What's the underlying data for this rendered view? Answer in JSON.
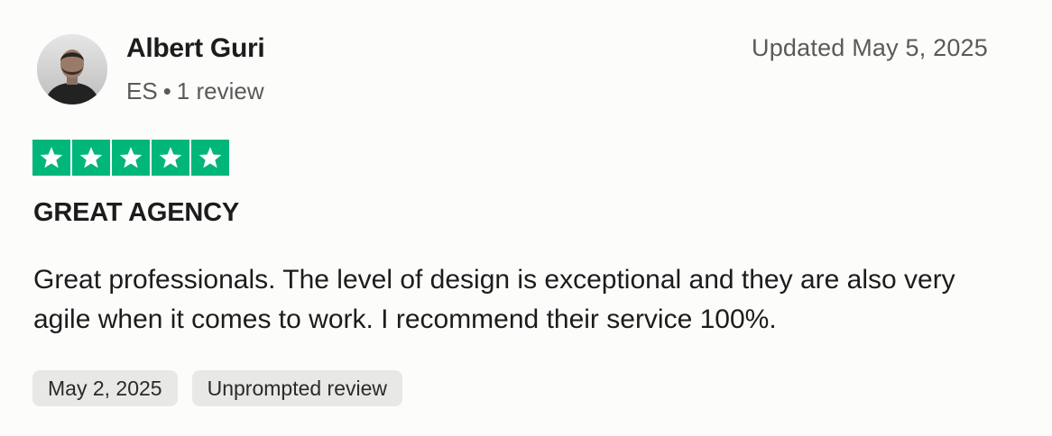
{
  "reviewer": {
    "name": "Albert Guri",
    "country": "ES",
    "separator": "•",
    "review_count": "1 review",
    "avatar": "avatar-photo"
  },
  "updated": "Updated May 5, 2025",
  "rating": {
    "value": 5,
    "max": 5,
    "color": "#00b67a"
  },
  "review": {
    "title": "GREAT AGENCY",
    "body": "Great professionals. The level of design is exceptional and they are also very agile when it comes to work. I recommend their service 100%."
  },
  "tags": [
    {
      "label": "May 2, 2025"
    },
    {
      "label": "Unprompted review"
    }
  ]
}
